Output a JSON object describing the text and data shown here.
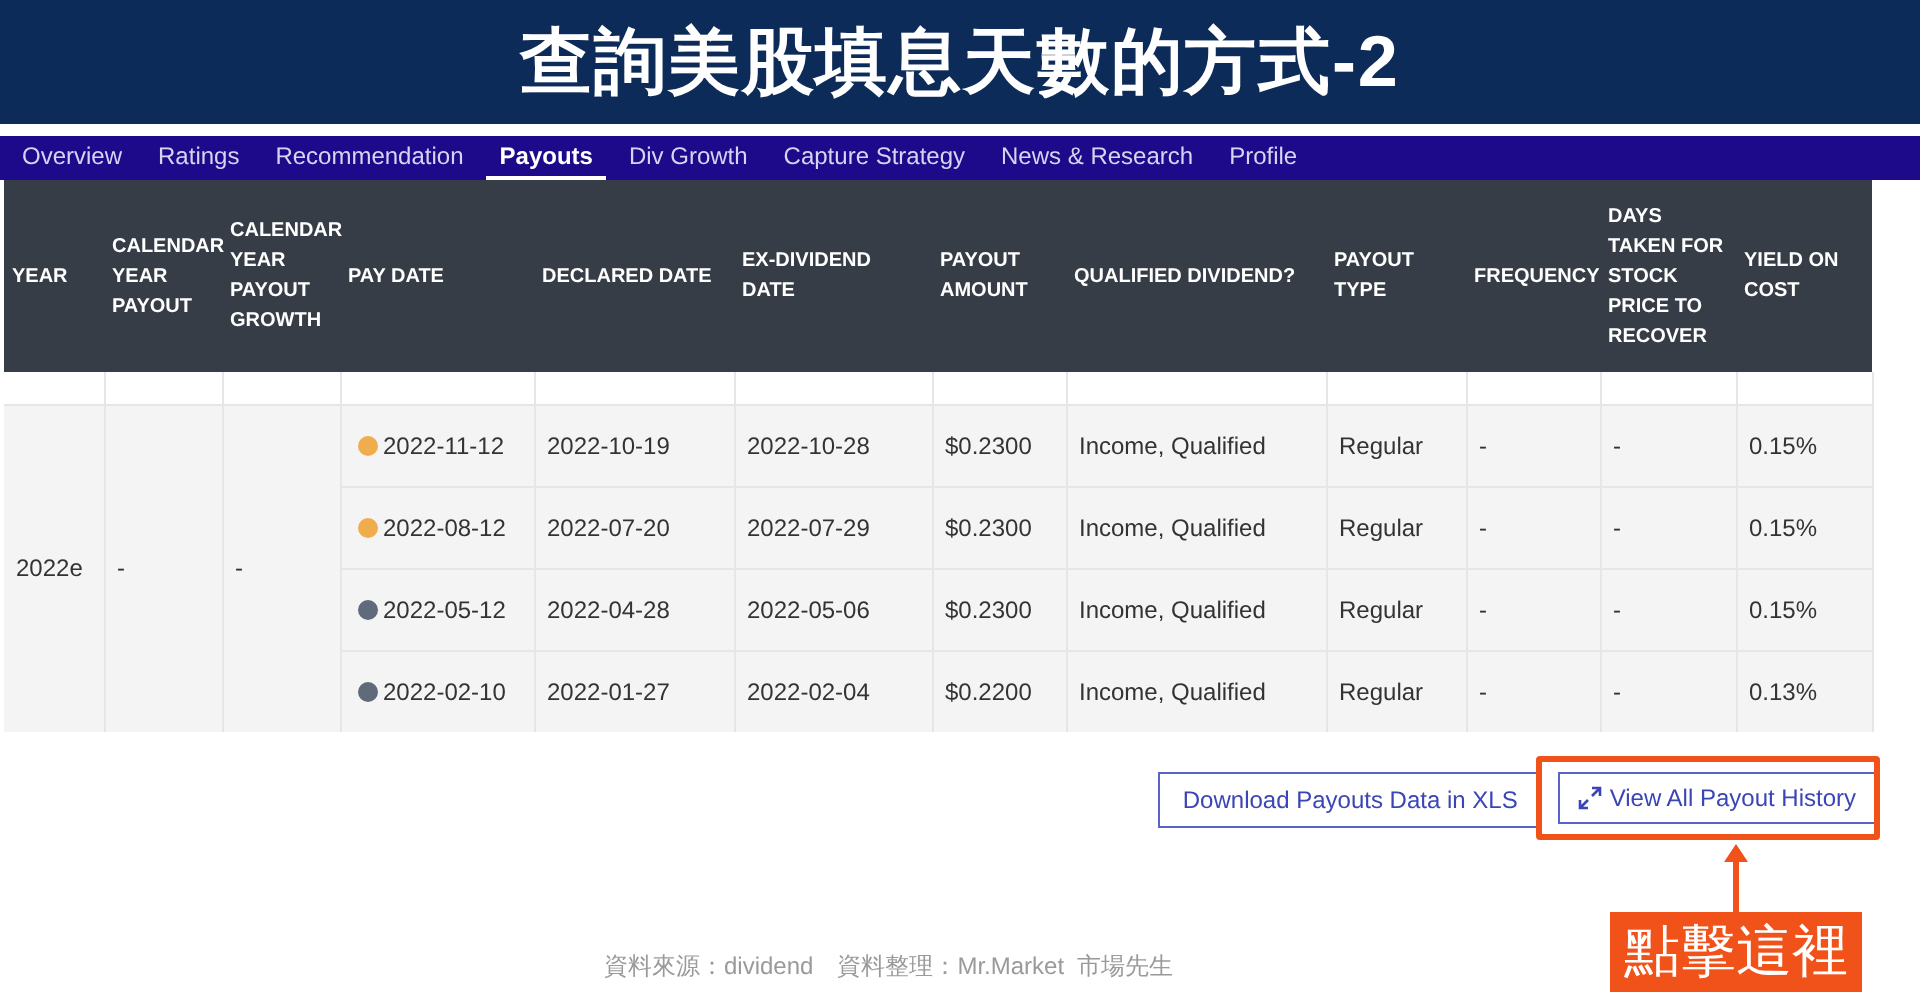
{
  "banner": {
    "title": "查詢美股填息天數的方式-2"
  },
  "tabs": [
    {
      "label": "Overview",
      "selected": false
    },
    {
      "label": "Ratings",
      "selected": false
    },
    {
      "label": "Recommendation",
      "selected": false
    },
    {
      "label": "Payouts",
      "selected": true
    },
    {
      "label": "Div Growth",
      "selected": false
    },
    {
      "label": "Capture Strategy",
      "selected": false
    },
    {
      "label": "News & Research",
      "selected": false
    },
    {
      "label": "Profile",
      "selected": false
    }
  ],
  "table": {
    "columns": [
      "YEAR",
      "CALENDAR YEAR PAYOUT",
      "CALENDAR YEAR PAYOUT GROWTH",
      "PAY DATE",
      "DECLARED DATE",
      "EX-DIVIDEND DATE",
      "PAYOUT AMOUNT",
      "QUALIFIED DIVIDEND?",
      "PAYOUT TYPE",
      "FREQUENCY",
      "DAYS TAKEN FOR STOCK PRICE TO RECOVER",
      "YIELD ON COST"
    ],
    "year": "2022e",
    "calendar_year_payout": "-",
    "calendar_year_payout_growth": "-",
    "rows": [
      {
        "pay_date": "2022-11-12",
        "color": "#f0ad4e",
        "declared_date": "2022-10-19",
        "ex_dividend_date": "2022-10-28",
        "payout_amount": "$0.2300",
        "qualified": "Income, Qualified",
        "payout_type": "Regular",
        "frequency": "-",
        "days_to_recover": "-",
        "yield_on_cost": "0.15%"
      },
      {
        "pay_date": "2022-08-12",
        "color": "#f0ad4e",
        "declared_date": "2022-07-20",
        "ex_dividend_date": "2022-07-29",
        "payout_amount": "$0.2300",
        "qualified": "Income, Qualified",
        "payout_type": "Regular",
        "frequency": "-",
        "days_to_recover": "-",
        "yield_on_cost": "0.15%"
      },
      {
        "pay_date": "2022-05-12",
        "color": "#5f6b7a",
        "declared_date": "2022-04-28",
        "ex_dividend_date": "2022-05-06",
        "payout_amount": "$0.2300",
        "qualified": "Income, Qualified",
        "payout_type": "Regular",
        "frequency": "-",
        "days_to_recover": "-",
        "yield_on_cost": "0.15%"
      },
      {
        "pay_date": "2022-02-10",
        "color": "#5f6b7a",
        "declared_date": "2022-01-27",
        "ex_dividend_date": "2022-02-04",
        "payout_amount": "$0.2200",
        "qualified": "Income, Qualified",
        "payout_type": "Regular",
        "frequency": "-",
        "days_to_recover": "-",
        "yield_on_cost": "0.13%"
      }
    ]
  },
  "buttons": [
    "Download Payouts Data in XLS",
    "View All Payout History"
  ],
  "annotation": {
    "label": "點擊這裡"
  },
  "footer": "資料來源：dividend　資料整理：Mr.Market  市場先生"
}
